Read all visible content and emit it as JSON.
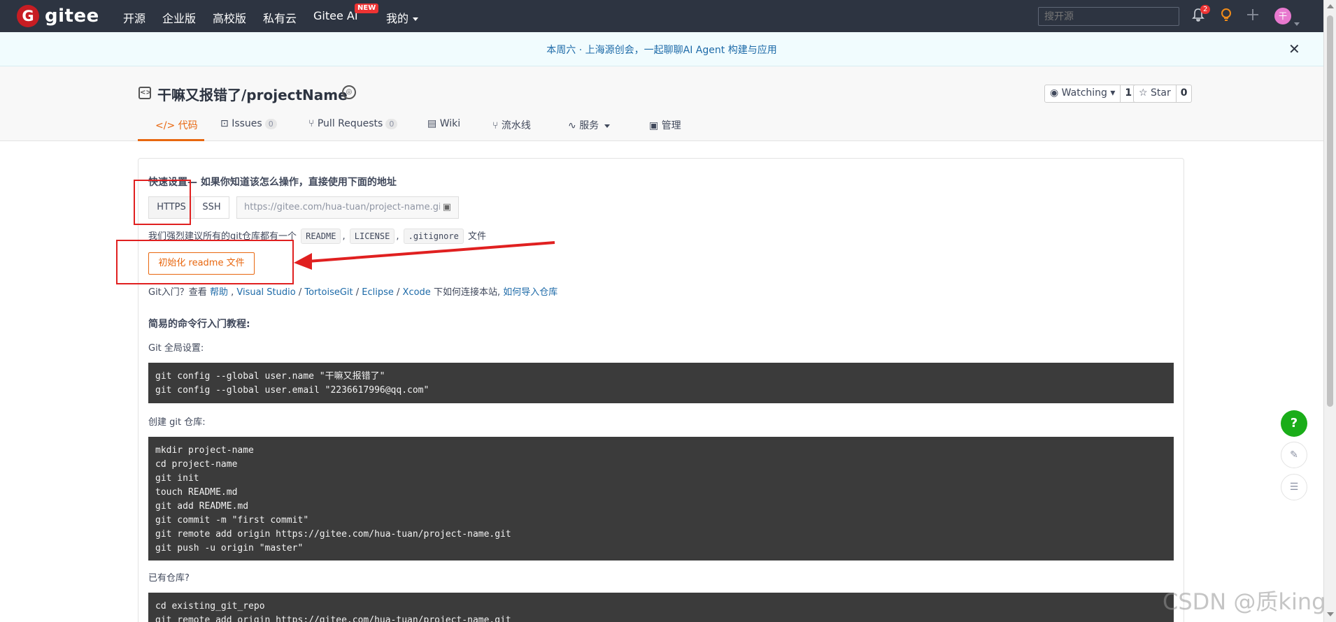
{
  "topnav": {
    "logo_mark": "G",
    "logo_text": "gitee",
    "items": [
      "开源",
      "企业版",
      "高校版",
      "私有云",
      "Gitee AI",
      "我的"
    ],
    "new_badge": "NEW",
    "search_placeholder": "搜开源",
    "notification_count": "2",
    "avatar_letter": "干"
  },
  "announcement": {
    "text": "本周六 · 上海源创会，一起聊聊AI Agent 构建与应用",
    "close": "✕"
  },
  "repo": {
    "title": "干嘛又报错了/projectName",
    "watch_label": "Watching ▾",
    "watch_count": "1",
    "star_label": "☆ Star",
    "star_count": "0",
    "tabs": [
      {
        "label": "代码",
        "icon": "</>"
      },
      {
        "label": "Issues",
        "count": "0",
        "icon": "⊡"
      },
      {
        "label": "Pull Requests",
        "count": "0",
        "icon": "⑂"
      },
      {
        "label": "Wiki",
        "icon": "▤"
      },
      {
        "label": "流水线",
        "icon": "⑂"
      },
      {
        "label": "服务",
        "icon": "∿"
      },
      {
        "label": "管理",
        "icon": "▣"
      }
    ]
  },
  "quick_setup": {
    "title": "快速设置— 如果你知道该怎么操作，直接使用下面的地址",
    "https_label": "HTTPS",
    "ssh_label": "SSH",
    "url_value": "https://gitee.com/hua-tuan/project-name.git",
    "suggest_prefix": "我们强烈建议所有的git仓库都有一个",
    "chips": [
      "README",
      "LICENSE",
      ".gitignore"
    ],
    "suggest_suffix": "文件",
    "sep": ",",
    "init_button": "初始化 readme 文件",
    "git_intro_prefix": "Git入门？查看",
    "git_intro_links": [
      "帮助",
      "Visual Studio",
      "TortoiseGit",
      "Eclipse",
      "Xcode"
    ],
    "git_intro_mid": "下如何连接本站,",
    "git_intro_last_link": "如何导入仓库"
  },
  "tutorial": {
    "title": "简易的命令行入门教程:",
    "global_label": "Git 全局设置:",
    "global_code": "git config --global user.name \"干嘛又报错了\"\ngit config --global user.email \"2236617996@qq.com\"",
    "create_label": "创建 git 仓库:",
    "create_code": "mkdir project-name\ncd project-name\ngit init\ntouch README.md\ngit add README.md\ngit commit -m \"first commit\"\ngit remote add origin https://gitee.com/hua-tuan/project-name.git\ngit push -u origin \"master\"",
    "existing_label": "已有仓库?",
    "existing_code": "cd existing_git_repo\ngit remote add origin https://gitee.com/hua-tuan/project-name.git"
  },
  "floating": {
    "help": "?",
    "edit": "✎",
    "chat": "☰"
  },
  "watermark": "CSDN @质king",
  "colors": {
    "nav_bg": "#2d3441",
    "accent": "#e8670f",
    "link": "#1d6aa8",
    "annotation": "#e02020",
    "help_green": "#1aad19"
  }
}
